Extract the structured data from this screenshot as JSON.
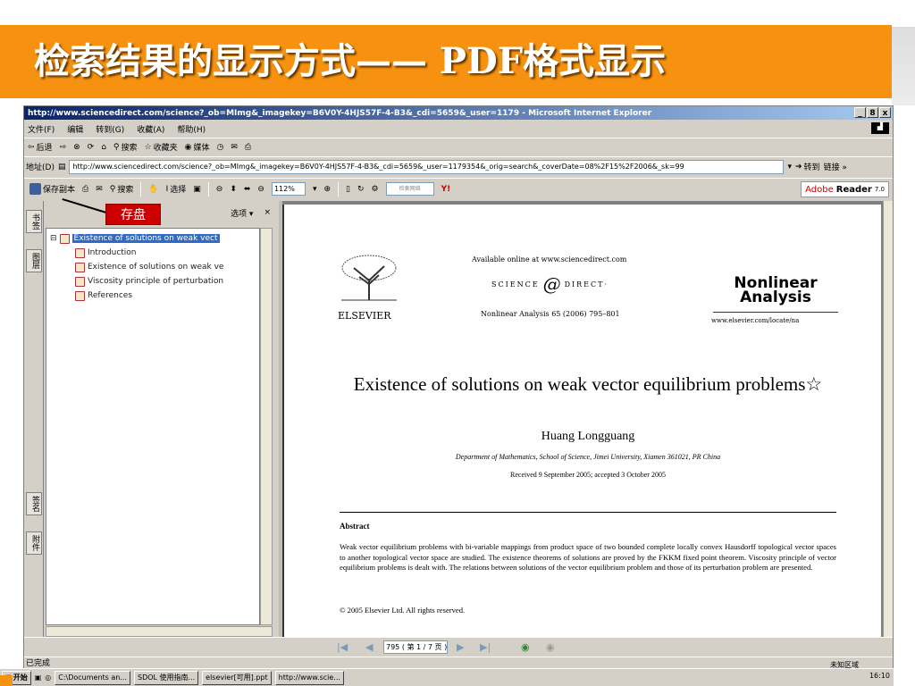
{
  "banner": {
    "title": "检索结果的显示方式—— PDF格式显示"
  },
  "window": {
    "title": "http://www.sciencedirect.com/science?_ob=MImg&_imagekey=B6V0Y-4HJS57F-4-B3&_cdi=5659&_user=1179 - Microsoft Internet Explorer",
    "buttons": [
      "_",
      "8",
      "x"
    ]
  },
  "menu": {
    "items": [
      "文件(F)",
      "编辑",
      "转到(G)",
      "收藏(A)",
      "帮助(H)"
    ]
  },
  "std_toolbar": {
    "back": "后退",
    "search": "搜索",
    "favorites": "收藏夹",
    "media": "媒体"
  },
  "address": {
    "label": "地址(D)",
    "url": "http://www.sciencedirect.com/science?_ob=MImg&_imagekey=B6V0Y-4HJS57F-4-B3&_cdi=5659&_user=1179354&_orig=search&_coverDate=08%2F15%2F2006&_sk=99",
    "go": "转到",
    "links": "链接 »"
  },
  "pdf_toolbar": {
    "save": "保存副本",
    "search": "搜索",
    "select": "选择",
    "zoom": "112%",
    "search_field": "检索网络",
    "adobe_reader": "Adobe",
    "adobe_reader_2": "Reader",
    "adobe_version": "7.0"
  },
  "callout": {
    "text": "存盘"
  },
  "bookmarks": {
    "options": "选项 ▾",
    "close": "×",
    "items": [
      {
        "label": "Existence of solutions on weak vect"
      },
      {
        "label": "Introduction"
      },
      {
        "label": "Existence of solutions on weak ve"
      },
      {
        "label": "Viscosity principle of perturbation"
      },
      {
        "label": "References"
      }
    ],
    "tabs": [
      "书签",
      "图层",
      "签名",
      "附件"
    ]
  },
  "paper": {
    "available_online": "Available online at www.sciencedirect.com",
    "sd_left": "SCIENCE",
    "sd_at": "@",
    "sd_right": "DIRECT·",
    "publisher": "ELSEVIER",
    "citation": "Nonlinear Analysis 65 (2006) 795–801",
    "journal": "Nonlinear Analysis",
    "journal_url": "www.elsevier.com/locate/na",
    "title": "Existence of solutions on weak vector equilibrium problems☆",
    "author": "Huang Longguang",
    "affiliation": "Department of Mathematics, School of Science, Jimei University, Xiamen 361021, PR China",
    "received": "Received 9 September 2005; accepted 3 October 2005",
    "abstract_heading": "Abstract",
    "abstract": "Weak vector equilibrium problems with bi-variable mappings from product space of two bounded complete locally convex Hausdorff topological vector spaces to another topological vector space are studied. The existence theorems of solutions are proved by the FKKM fixed point theorem. Viscosity principle of vector equilibrium problems is dealt with. The relations between solutions of the vector equilibrium problem and those of its perturbation problem are presented.",
    "copyright": "© 2005 Elsevier Ltd. All rights reserved."
  },
  "pagination": {
    "page_field": "795 ( 第 1 / 7 页 )"
  },
  "status": {
    "text": "已完成",
    "zone": "未知区域"
  },
  "taskbar": {
    "start": "开始",
    "tasks": [
      "C:\\Documents an...",
      "SDOL 使用指南...",
      "elsevier[可用].ppt",
      "http://www.scie..."
    ],
    "clock": "16:10"
  },
  "colors": {
    "banner": "#f6920f",
    "callout": "#cc0000",
    "selection": "#316ac5"
  }
}
